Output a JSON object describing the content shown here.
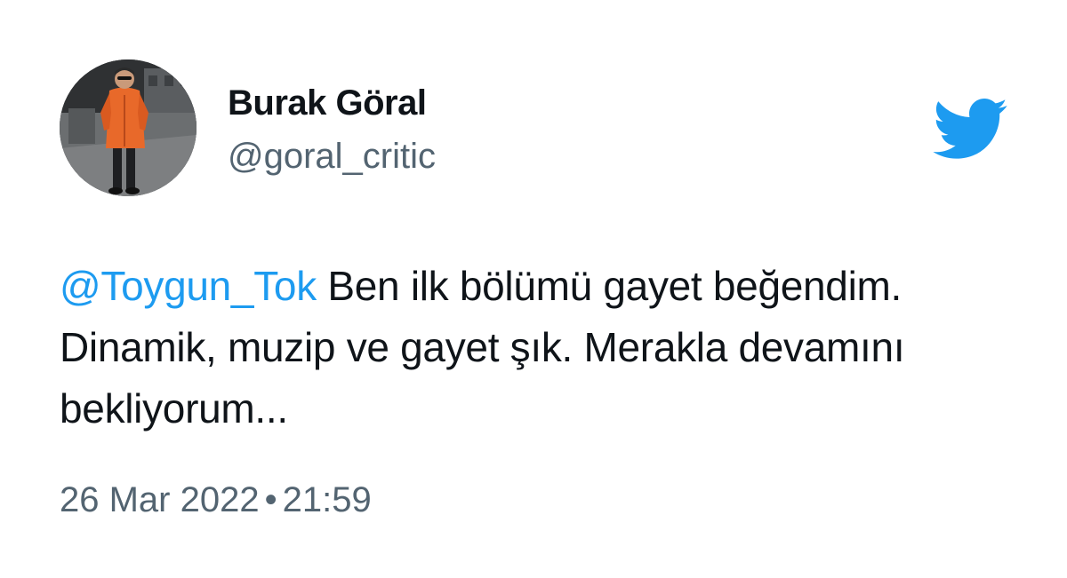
{
  "user": {
    "display_name": "Burak Göral",
    "handle": "@goral_critic"
  },
  "tweet": {
    "mention": "@Toygun_Tok",
    "line1": " Ben ilk bölümü gayet beğendim.",
    "line2": "Dinamik, muzip ve gayet şık. Merakla devamını",
    "line3": "bekliyorum..."
  },
  "meta": {
    "date": "26 Mar 2022",
    "separator": "•",
    "time": "21:59"
  },
  "colors": {
    "link": "#1d9bf0",
    "text": "#0f1419",
    "muted": "#536471",
    "bird": "#1d9bf0"
  },
  "icons": {
    "brand": "twitter-bird-icon"
  }
}
